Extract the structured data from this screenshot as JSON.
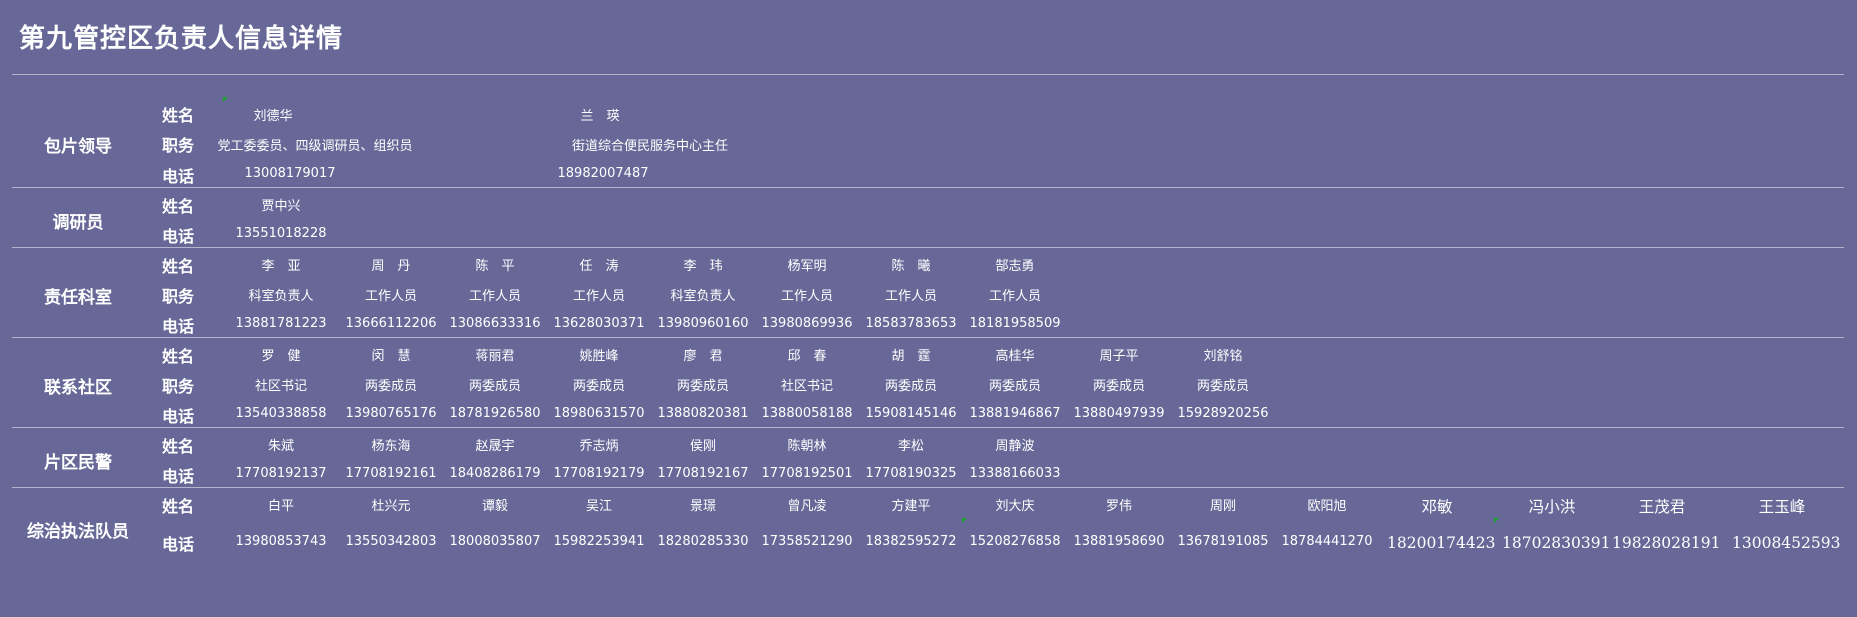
{
  "page_title": "第九管控区负责人信息详情",
  "labels": {
    "name": "姓名",
    "position": "职务",
    "phone": "电话"
  },
  "sections": {
    "leaders": {
      "title": "包片领导",
      "names": [
        "刘德华",
        "兰　瑛"
      ],
      "positions": [
        "党工委委员、四级调研员、组织员",
        "街道综合便民服务中心主任"
      ],
      "phones": [
        "13008179017",
        "18982007487"
      ]
    },
    "researcher": {
      "title": "调研员",
      "names": [
        "贾中兴"
      ],
      "phones": [
        "13551018228"
      ]
    },
    "office": {
      "title": "责任科室",
      "names": [
        "李　亚",
        "周　丹",
        "陈　平",
        "任　涛",
        "李　玮",
        "杨军明",
        "陈　曦",
        "郜志勇"
      ],
      "positions": [
        "科室负责人",
        "工作人员",
        "工作人员",
        "工作人员",
        "科室负责人",
        "工作人员",
        "工作人员",
        "工作人员"
      ],
      "phones": [
        "13881781223",
        "13666112206",
        "13086633316",
        "13628030371",
        "13980960160",
        "13980869936",
        "18583783653",
        "18181958509"
      ]
    },
    "community": {
      "title": "联系社区",
      "names": [
        "罗　健",
        "闵　慧",
        "蒋丽君",
        "姚胜峰",
        "廖　君",
        "邱　春",
        "胡　霆",
        "高桂华",
        "周子平",
        "刘舒铭"
      ],
      "positions": [
        "社区书记",
        "两委成员",
        "两委成员",
        "两委成员",
        "两委成员",
        "社区书记",
        "两委成员",
        "两委成员",
        "两委成员",
        "两委成员"
      ],
      "phones": [
        "13540338858",
        "13980765176",
        "18781926580",
        "18980631570",
        "13880820381",
        "13880058188",
        "15908145146",
        "13881946867",
        "13880497939",
        "15928920256"
      ]
    },
    "police": {
      "title": "片区民警",
      "names": [
        "朱斌",
        "杨东海",
        "赵晟宇",
        "乔志炳",
        "侯刚",
        "陈朝林",
        "李松",
        "周静波"
      ],
      "phones": [
        "17708192137",
        "17708192161",
        "18408286179",
        "17708192179",
        "17708192167",
        "17708192501",
        "17708190325",
        "13388166033"
      ]
    },
    "enforcement": {
      "title": "综治执法队员",
      "names": [
        "白平",
        "杜兴元",
        "谭毅",
        "吴江",
        "景璟",
        "曾凡凌",
        "方建平",
        "刘大庆",
        "罗伟",
        "周刚",
        "欧阳旭",
        "邓敏",
        "冯小洪",
        "王茂君",
        "王玉峰"
      ],
      "phones": [
        "13980853743",
        "13550342803",
        "18008035807",
        "15982253941",
        "18280285330",
        "17358521290",
        "18382595272",
        "15208276858",
        "13881958690",
        "13678191085",
        "18784441270",
        "18200174423",
        "18702830391",
        "19828028191",
        "13008452593"
      ]
    }
  }
}
